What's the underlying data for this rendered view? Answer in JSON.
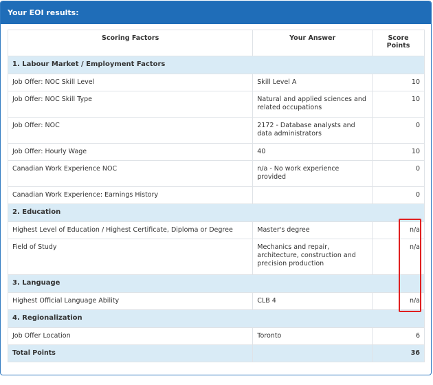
{
  "panel": {
    "title": "Your EOI results:"
  },
  "table": {
    "headers": {
      "factor": "Scoring Factors",
      "answer": "Your Answer",
      "score": "Score Points"
    },
    "sections": [
      {
        "title": "1. Labour Market / Employment Factors",
        "rows": [
          {
            "factor": "Job Offer: NOC Skill Level",
            "answer": "Skill Level A",
            "score": "10"
          },
          {
            "factor": "Job Offer: NOC Skill Type",
            "answer": "Natural and applied sciences and related occupations",
            "score": "10"
          },
          {
            "factor": "Job Offer: NOC",
            "answer": "2172 - Database analysts and data administrators",
            "score": "0"
          },
          {
            "factor": "Job Offer: Hourly Wage",
            "answer": "40",
            "score": "10"
          },
          {
            "factor": "Canadian Work Experience NOC",
            "answer": "n/a - No work experience provided",
            "score": "0"
          },
          {
            "factor": "Canadian Work Experience: Earnings History",
            "answer": "",
            "score": "0"
          }
        ]
      },
      {
        "title": "2. Education",
        "rows": [
          {
            "factor": "Highest Level of Education / Highest Certificate, Diploma or Degree",
            "answer": "Master's degree",
            "score": "n/a"
          },
          {
            "factor": "Field of Study",
            "answer": "Mechanics and repair, architecture, construction and precision production",
            "score": "n/a"
          }
        ]
      },
      {
        "title": "3. Language",
        "rows": [
          {
            "factor": "Highest Official Language Ability",
            "answer": "CLB 4",
            "score": "n/a"
          }
        ]
      },
      {
        "title": "4. Regionalization",
        "rows": [
          {
            "factor": "Job Offer Location",
            "answer": "Toronto",
            "score": "6"
          }
        ]
      }
    ],
    "total": {
      "label": "Total Points",
      "score": "36"
    }
  },
  "colors": {
    "header": "#1f6db8",
    "section_bg": "#d9ebf6",
    "highlight": "#e02020"
  }
}
